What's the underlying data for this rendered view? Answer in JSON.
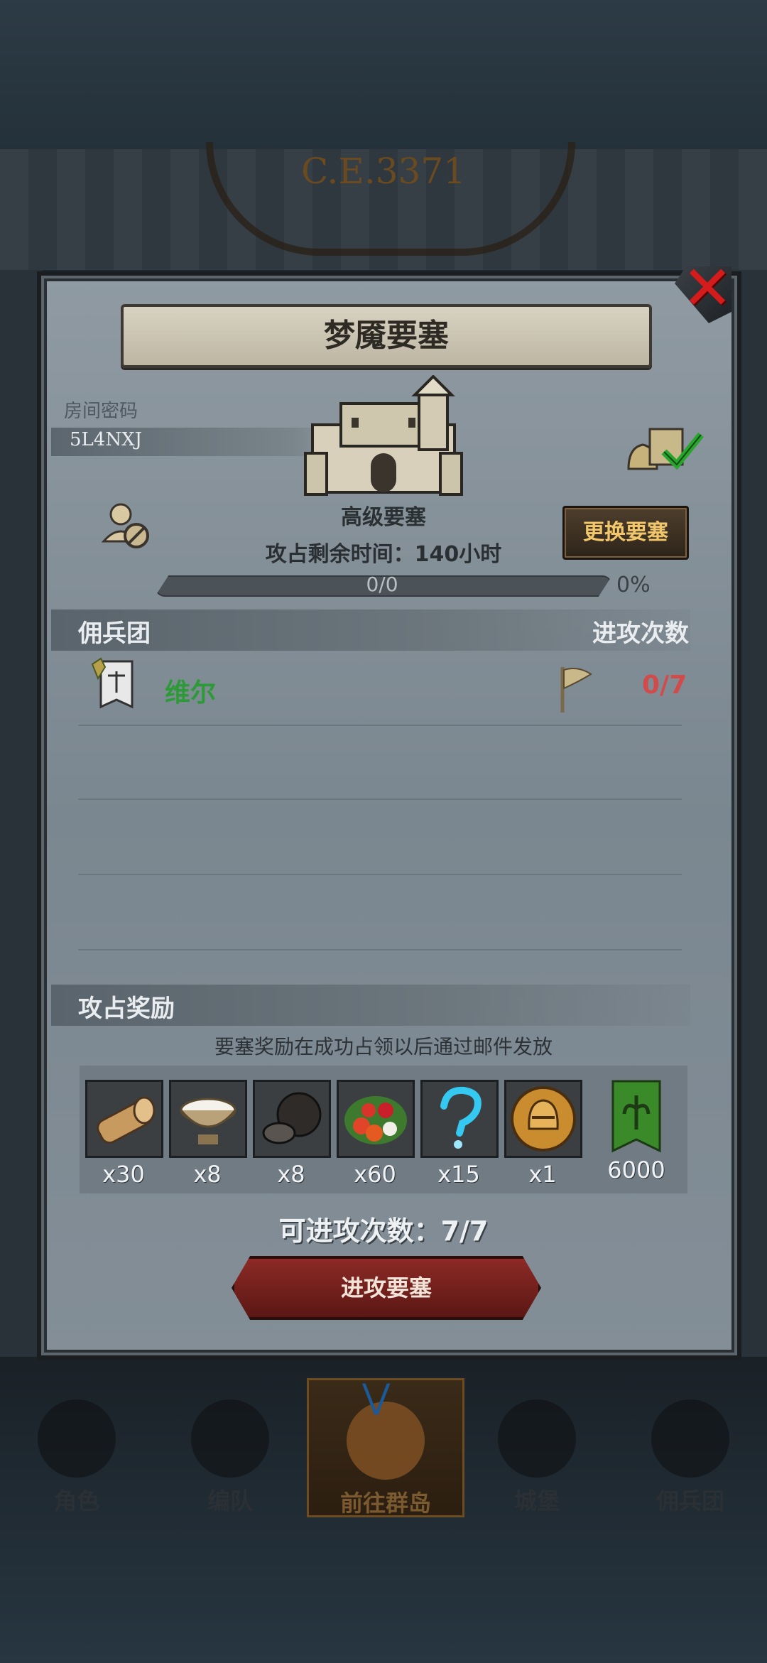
{
  "background": {
    "era": "C.E.3371"
  },
  "dialog": {
    "title": "梦魇要塞",
    "room": {
      "label": "房间密码",
      "code": "5L4NXJ"
    },
    "fortress": {
      "level": "高级要塞",
      "time_left": "攻占剩余时间：140小时",
      "progress_text": "0/0",
      "progress_percent": "0%",
      "progress_fraction": 0
    },
    "change_button": "更换要塞",
    "mercenary_section": {
      "left": "佣兵团",
      "right": "进攻次数"
    },
    "members": [
      {
        "name": "维尔",
        "attacks": "0/7"
      }
    ],
    "reward_section": {
      "title": "攻占奖励",
      "note": "要塞奖励在成功占领以后通过邮件发放",
      "items": [
        {
          "icon": "wood-log-icon",
          "qty": "x30"
        },
        {
          "icon": "milk-bowl-icon",
          "qty": "x8"
        },
        {
          "icon": "truffle-icon",
          "qty": "x8"
        },
        {
          "icon": "berries-icon",
          "qty": "x60"
        },
        {
          "icon": "blue-question-icon",
          "qty": "x15"
        },
        {
          "icon": "helmet-coin-icon",
          "qty": "x1"
        },
        {
          "icon": "guild-banner-icon",
          "qty": "6000"
        }
      ]
    },
    "attacks_available": "可进攻次数：7/7",
    "attack_button": "进攻要塞"
  },
  "nav": [
    {
      "label": "角色",
      "active": false
    },
    {
      "label": "编队",
      "active": false
    },
    {
      "label": "前往群岛",
      "active": true
    },
    {
      "label": "城堡",
      "active": false
    },
    {
      "label": "佣兵团",
      "active": false
    }
  ],
  "colors": {
    "member_name": "#2d9a38",
    "attack_count": "#d24b4b",
    "change_text": "#f2c76b",
    "close": "#d51c1c"
  }
}
